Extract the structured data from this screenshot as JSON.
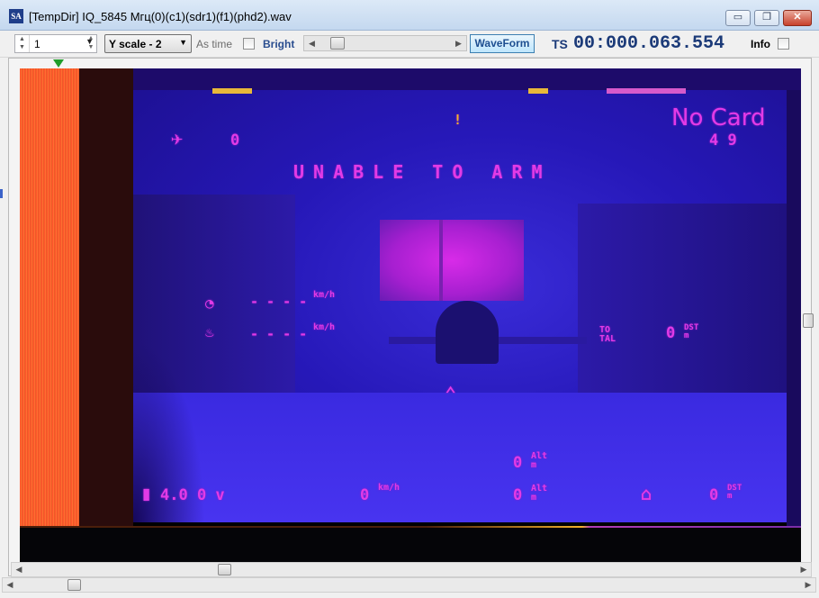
{
  "window": {
    "title": "[TempDir] IQ_5845 Мгц(0)(c1)(sdr1)(f1)(phd2).wav",
    "app_icon": "SA",
    "min_glyph": "▭",
    "max_glyph": "❐",
    "close_glyph": "✕"
  },
  "toolbar": {
    "spin_value": "1",
    "y_scale": "Y scale - 2",
    "as_time_label": "As time",
    "bright_label": "Bright",
    "waveform_label": "WaveForm",
    "ts_label": "TS",
    "ts_value": "00:000.063.554",
    "info_label": "Info"
  },
  "osd": {
    "no_card": "No Card",
    "signal": "4 9",
    "sats": "0",
    "warning": "!",
    "unable_to_arm": "UNABLE TO ARM",
    "speed_dashes_1": "- - - -",
    "speed_dashes_2": "- - - -",
    "kmh_unit": "km/h",
    "to_tal": "TO TAL",
    "dist_value": "0",
    "dist_unit": "DST m",
    "alt_value_1": "0",
    "alt_unit": "Alt m",
    "battery": "4.0 0 v",
    "speed_value": "0",
    "alt_value_2": "0",
    "home_value": "0",
    "home_unit": "DST m"
  },
  "colors": {
    "osd": "#e23be6",
    "ts": "#1b3a78",
    "sync": "#ff4b2a",
    "marker": "#1f9d2a"
  }
}
